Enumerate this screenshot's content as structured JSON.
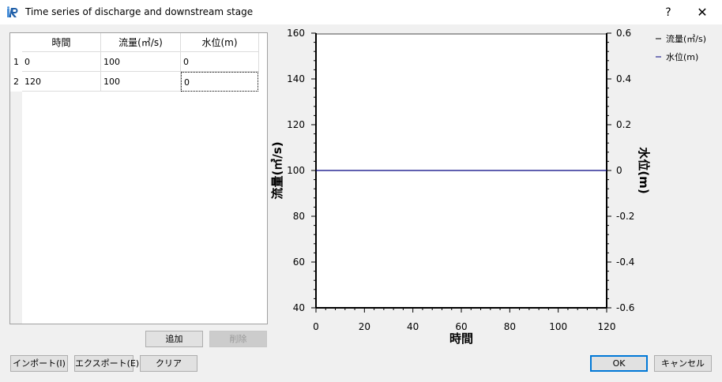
{
  "window": {
    "title": "Time series of discharge and downstream stage",
    "help": "?",
    "close": "✕",
    "icon": "app-logo-icon"
  },
  "table": {
    "columns": [
      "時間",
      "流量(㎥/s)",
      "水位(m)"
    ],
    "rows": [
      {
        "num": "1",
        "cells": [
          "0",
          "100",
          "0"
        ]
      },
      {
        "num": "2",
        "cells": [
          "120",
          "100",
          "0"
        ]
      }
    ]
  },
  "buttons": {
    "add": "追加",
    "delete": "削除",
    "import": "インポート(I)",
    "export": "エクスポート(E)",
    "clear": "クリア",
    "ok": "OK",
    "cancel": "キャンセル"
  },
  "chart_data": {
    "type": "line",
    "xlabel": "時間",
    "ylabel_left": "流量(㎥/s)",
    "ylabel_right": "水位(m)",
    "x_ticks": [
      "0",
      "20",
      "40",
      "60",
      "80",
      "100",
      "120"
    ],
    "y_left_ticks": [
      "40",
      "60",
      "80",
      "100",
      "120",
      "140",
      "160"
    ],
    "y_right_ticks": [
      "-0.6",
      "-0.4",
      "-0.2",
      "0",
      "0.2",
      "0.4",
      "0.6"
    ],
    "xlim": [
      0,
      120
    ],
    "ylim_left": [
      40,
      160
    ],
    "ylim_right": [
      -0.6,
      0.6
    ],
    "legend_position": "top-right",
    "series": [
      {
        "name": "流量(㎥/s)",
        "axis": "left",
        "color": "#000000",
        "x": [
          0,
          120
        ],
        "y": [
          100,
          100
        ]
      },
      {
        "name": "水位(m)",
        "axis": "right",
        "color": "#000080",
        "x": [
          0,
          120
        ],
        "y": [
          0,
          0
        ]
      }
    ]
  }
}
